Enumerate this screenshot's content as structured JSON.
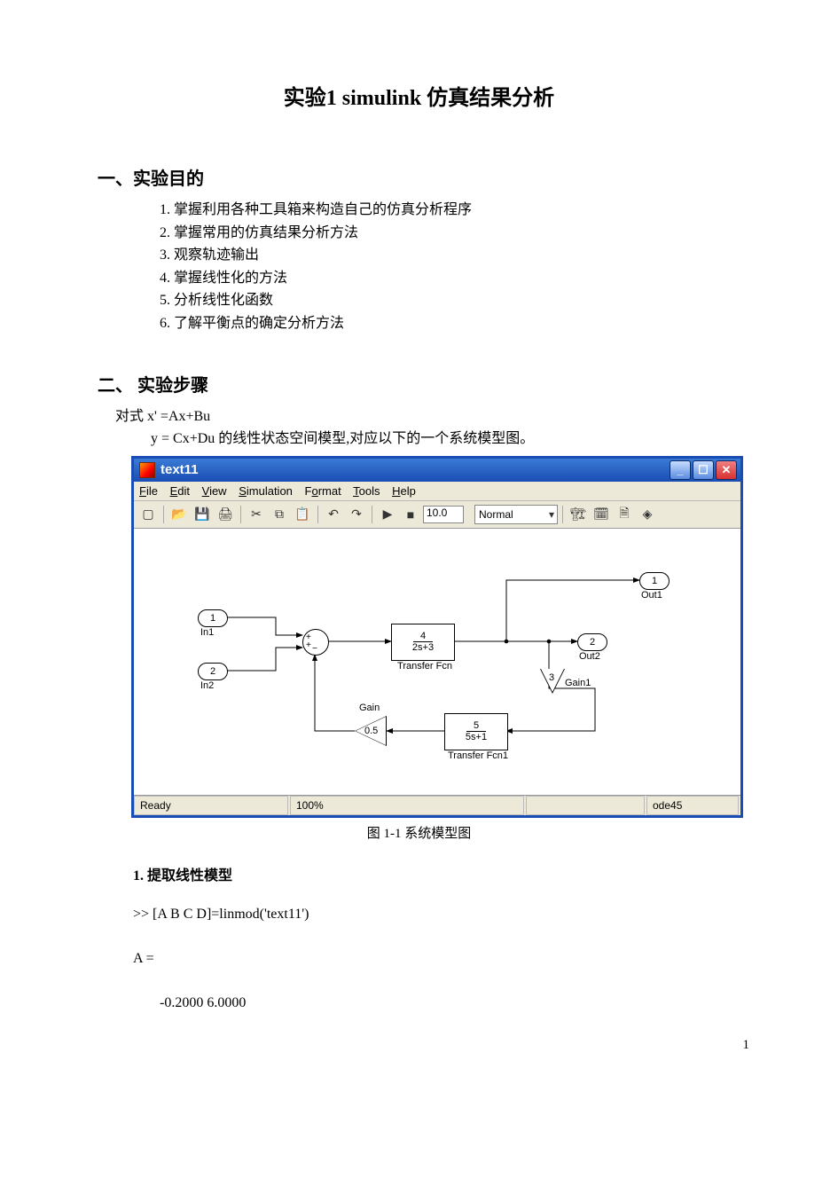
{
  "title": "实验1    simulink 仿真结果分析",
  "section1": {
    "heading": "一、实验目的",
    "items": [
      "1. 掌握利用各种工具箱来构造自己的仿真分析程序",
      "2. 掌握常用的仿真结果分析方法",
      "3. 观察轨迹输出",
      "4. 掌握线性化的方法",
      "5. 分析线性化函数",
      "6. 了解平衡点的确定分析方法"
    ]
  },
  "section2": {
    "heading": "二、 实验步骤",
    "eq_l1": "对式 x' =Ax+Bu",
    "eq_l2": "y = Cx+Du 的线性状态空间模型,对应以下的一个系统模型图。"
  },
  "window": {
    "title": "text11",
    "menus": {
      "file": "File",
      "edit": "Edit",
      "view": "View",
      "sim": "Simulation",
      "format": "Format",
      "tools": "Tools",
      "help": "Help"
    },
    "toolbar": {
      "stoptime": "10.0",
      "mode": "Normal"
    },
    "blocks": {
      "in1": "1",
      "in1_lab": "In1",
      "in2": "2",
      "in2_lab": "In2",
      "tf1_num": "4",
      "tf1_den": "2s+3",
      "tf1_lab": "Transfer Fcn",
      "tf2_num": "5",
      "tf2_den": "5s+1",
      "tf2_lab": "Transfer Fcn1",
      "gain_val": "0.5",
      "gain_lab": "Gain",
      "gain1_val": "3",
      "gain1_lab": "Gain1",
      "out1": "1",
      "out1_lab": "Out1",
      "out2": "2",
      "out2_lab": "Out2"
    },
    "status": {
      "ready": "Ready",
      "zoom": "100%",
      "solver": "ode45"
    }
  },
  "figcaption": "图 1-1    系统模型图",
  "sub1": "1. 提取线性模型",
  "code": {
    "l1": ">> [A  B  C  D]=linmod('text11')",
    "l2": "A =",
    "l3": "-0.2000       6.0000"
  },
  "page_number": "1"
}
